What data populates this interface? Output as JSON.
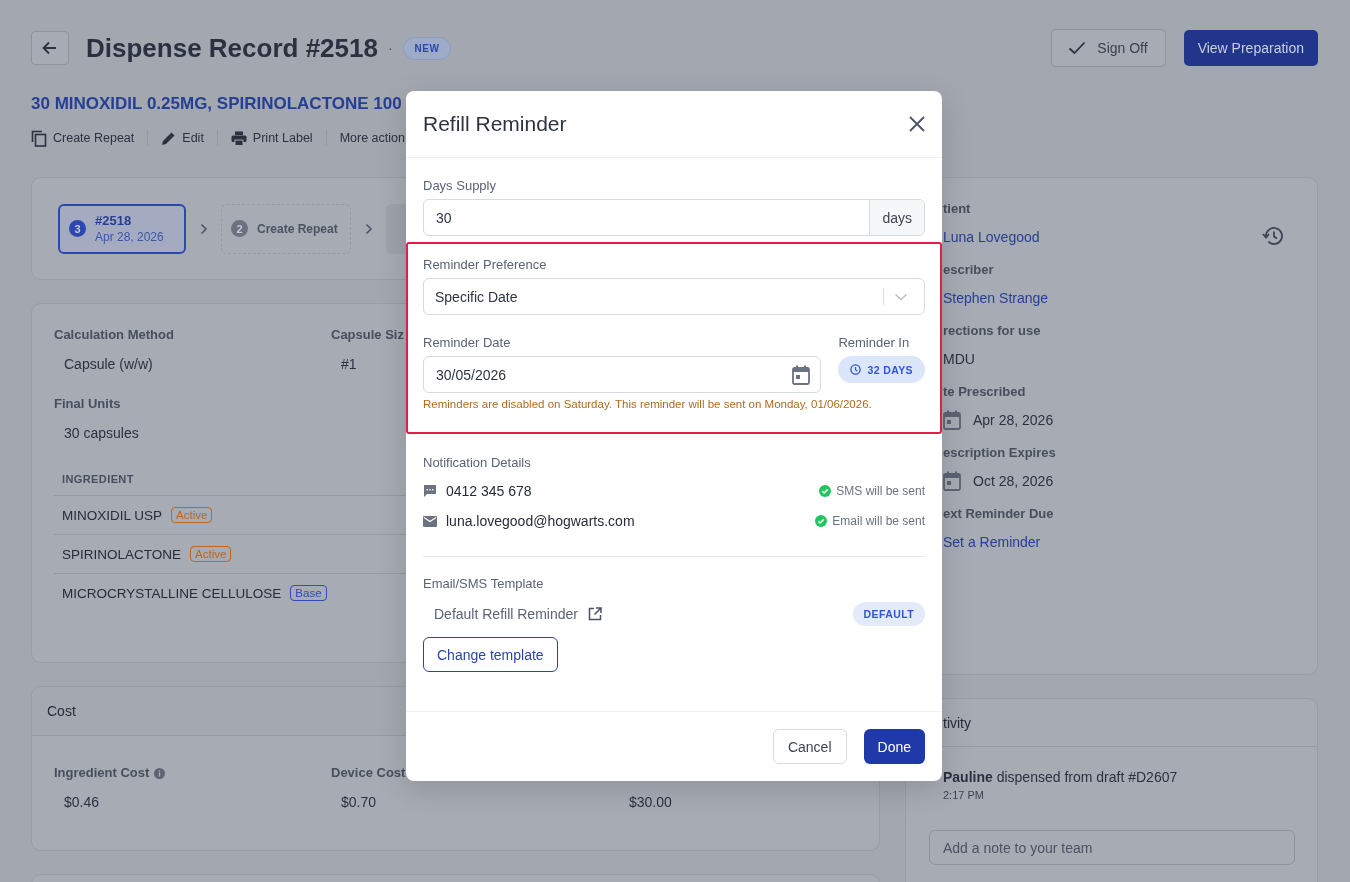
{
  "header": {
    "title": "Dispense Record #2518",
    "separator": "·",
    "badge": "NEW",
    "buttons": [
      {
        "label": "Sign Off",
        "kind": "secondary"
      },
      {
        "label": "View Preparation",
        "kind": "primary"
      }
    ]
  },
  "product": "30 MINOXIDIL 0.25MG, SPIRINOLACTONE 100",
  "actions": [
    {
      "label": "Create Repeat",
      "kind": "copy"
    },
    {
      "label": "Edit",
      "kind": "edit"
    },
    {
      "label": "Print Label",
      "kind": "print"
    },
    {
      "label": "More action",
      "kind": "more"
    }
  ],
  "steps": [
    {
      "number": "3",
      "title": "#2518",
      "date": "Apr 28, 2026",
      "selected": true
    },
    {
      "number": "2",
      "title": "Create Repeat",
      "selected": false
    }
  ],
  "details": {
    "fields": [
      {
        "label": "Calculation Method",
        "value": "Capsule (w/w)"
      },
      {
        "label": "Capsule Siz",
        "value": "#1"
      },
      {
        "label": "Final Units",
        "value": "30 capsules"
      }
    ],
    "ingredient_header": "INGREDIENT",
    "ingredients": [
      {
        "name": "MINOXIDIL USP",
        "tag": "Active",
        "color": "#c0651c"
      },
      {
        "name": "SPIRINOLACTONE",
        "tag": "Active",
        "color": "#c0651c"
      },
      {
        "name": "MICROCRYSTALLINE CELLULOSE",
        "tag": "Base",
        "color": "#2f4db5"
      }
    ]
  },
  "cost": {
    "title": "Cost",
    "fields": [
      {
        "label": "Ingredient Cost",
        "kind": "with_info",
        "value": "$0.46"
      },
      {
        "label": "Device Cost",
        "kind": "plain",
        "value": "$0.70"
      },
      {
        "value": "$30.00",
        "kind": "plain"
      }
    ]
  },
  "info": {
    "fields": [
      {
        "label": "tient",
        "value": "Luna Lovegood",
        "kind": "link"
      },
      {
        "label": "escriber",
        "value": "Stephen Strange",
        "kind": "link"
      },
      {
        "label": "rections for use",
        "value": "MDU",
        "kind": "text"
      },
      {
        "label": "te Prescribed",
        "value": "Apr 28, 2026",
        "kind": "date"
      },
      {
        "label": "escription Expires",
        "value": "Oct 28, 2026",
        "kind": "date"
      },
      {
        "label": "ext Reminder Due",
        "value": "Set a Reminder",
        "kind": "link"
      }
    ]
  },
  "activity": {
    "title": "tivity",
    "entries": [
      {
        "user": "Pauline",
        "text": "dispensed from draft #D2607",
        "time": "2:17 PM"
      }
    ],
    "note_placeholder": "Add a note to your team"
  },
  "modal": {
    "title": "Refill Reminder",
    "days_supply": {
      "label": "Days Supply",
      "value": "30",
      "unit": "days"
    },
    "highlighted": true,
    "preference": {
      "label": "Reminder Preference",
      "value": "Specific Date"
    },
    "reminder_date": {
      "label": "Reminder Date",
      "value": "30/05/2026"
    },
    "reminder_in": {
      "label": "Reminder In",
      "value": "32 DAYS"
    },
    "warning": "Reminders are disabled on Saturday. This reminder will be sent on Monday, 01/06/2026.",
    "notifications": {
      "label": "Notification Details",
      "items": [
        {
          "kind": "sms",
          "contact": "0412 345 678",
          "status": "SMS will be sent",
          "ok": true
        },
        {
          "kind": "email",
          "contact": "luna.lovegood@hogwarts.com",
          "status": "Email will be sent",
          "ok": true
        }
      ]
    },
    "template": {
      "label": "Email/SMS Template",
      "name": "Default Refill Reminder",
      "badge": "DEFAULT",
      "button": "Change template"
    },
    "buttons": [
      {
        "label": "Cancel",
        "kind": "secondary"
      },
      {
        "label": "Done",
        "kind": "primary"
      }
    ]
  }
}
